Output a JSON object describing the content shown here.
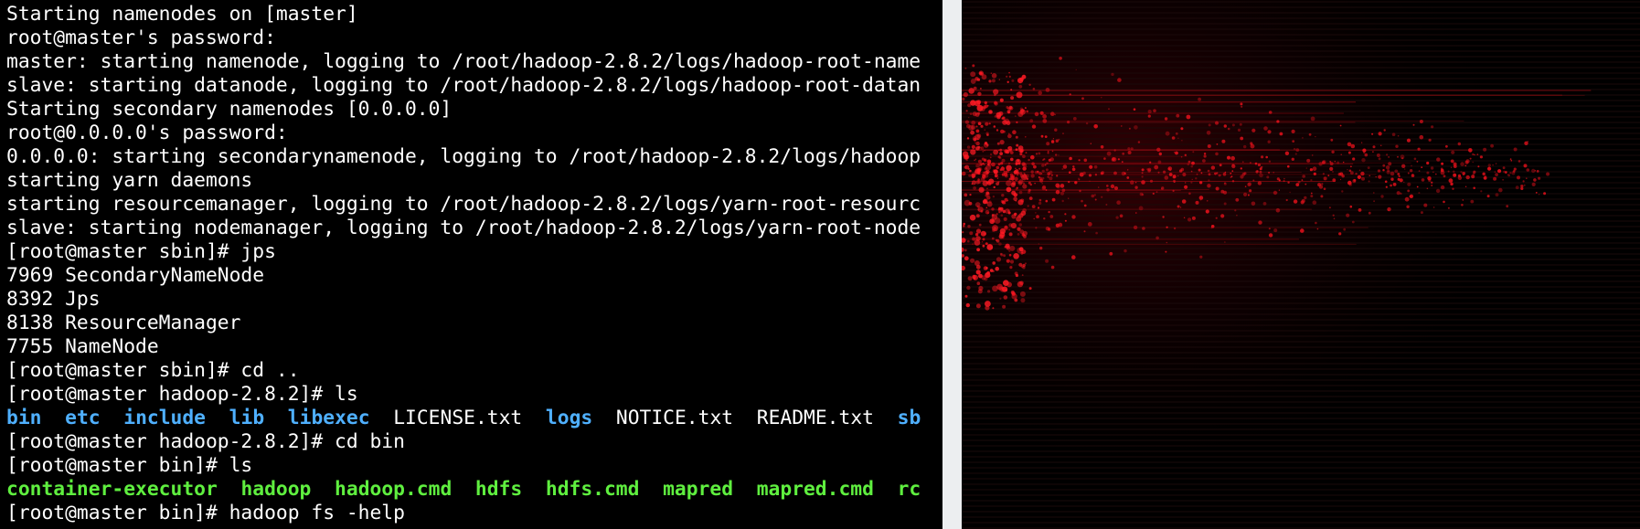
{
  "terminal": {
    "lines": [
      [
        {
          "t": "Starting namenodes on [master]",
          "c": "plain"
        }
      ],
      [
        {
          "t": "root@master's password:",
          "c": "plain"
        }
      ],
      [
        {
          "t": "master: starting namenode, logging to /root/hadoop-2.8.2/logs/hadoop-root-name",
          "c": "plain"
        }
      ],
      [
        {
          "t": "slave: starting datanode, logging to /root/hadoop-2.8.2/logs/hadoop-root-datan",
          "c": "plain"
        }
      ],
      [
        {
          "t": "Starting secondary namenodes [0.0.0.0]",
          "c": "plain"
        }
      ],
      [
        {
          "t": "root@0.0.0.0's password:",
          "c": "plain"
        }
      ],
      [
        {
          "t": "0.0.0.0: starting secondarynamenode, logging to /root/hadoop-2.8.2/logs/hadoop",
          "c": "plain"
        }
      ],
      [
        {
          "t": "starting yarn daemons",
          "c": "plain"
        }
      ],
      [
        {
          "t": "starting resourcemanager, logging to /root/hadoop-2.8.2/logs/yarn-root-resourc",
          "c": "plain"
        }
      ],
      [
        {
          "t": "slave: starting nodemanager, logging to /root/hadoop-2.8.2/logs/yarn-root-node",
          "c": "plain"
        }
      ],
      [
        {
          "t": "[root@master sbin]# jps",
          "c": "plain"
        }
      ],
      [
        {
          "t": "7969 SecondaryNameNode",
          "c": "plain"
        }
      ],
      [
        {
          "t": "8392 Jps",
          "c": "plain"
        }
      ],
      [
        {
          "t": "8138 ResourceManager",
          "c": "plain"
        }
      ],
      [
        {
          "t": "7755 NameNode",
          "c": "plain"
        }
      ],
      [
        {
          "t": "[root@master sbin]# cd ..",
          "c": "plain"
        }
      ],
      [
        {
          "t": "[root@master hadoop-2.8.2]# ls",
          "c": "plain"
        }
      ],
      [
        {
          "t": "bin",
          "c": "dir"
        },
        {
          "t": "  ",
          "c": "plain"
        },
        {
          "t": "etc",
          "c": "dir"
        },
        {
          "t": "  ",
          "c": "plain"
        },
        {
          "t": "include",
          "c": "dir"
        },
        {
          "t": "  ",
          "c": "plain"
        },
        {
          "t": "lib",
          "c": "dir"
        },
        {
          "t": "  ",
          "c": "plain"
        },
        {
          "t": "libexec",
          "c": "dir"
        },
        {
          "t": "  ",
          "c": "plain"
        },
        {
          "t": "LICENSE.txt",
          "c": "file"
        },
        {
          "t": "  ",
          "c": "plain"
        },
        {
          "t": "logs",
          "c": "dir"
        },
        {
          "t": "  ",
          "c": "plain"
        },
        {
          "t": "NOTICE.txt",
          "c": "file"
        },
        {
          "t": "  ",
          "c": "plain"
        },
        {
          "t": "README.txt",
          "c": "file"
        },
        {
          "t": "  ",
          "c": "plain"
        },
        {
          "t": "sb",
          "c": "dir"
        }
      ],
      [
        {
          "t": "[root@master hadoop-2.8.2]# cd bin",
          "c": "plain"
        }
      ],
      [
        {
          "t": "[root@master bin]# ls",
          "c": "plain"
        }
      ],
      [
        {
          "t": "container-executor",
          "c": "exec"
        },
        {
          "t": "  ",
          "c": "plain"
        },
        {
          "t": "hadoop",
          "c": "exec"
        },
        {
          "t": "  ",
          "c": "plain"
        },
        {
          "t": "hadoop.cmd",
          "c": "exec"
        },
        {
          "t": "  ",
          "c": "plain"
        },
        {
          "t": "hdfs",
          "c": "exec"
        },
        {
          "t": "  ",
          "c": "plain"
        },
        {
          "t": "hdfs.cmd",
          "c": "exec"
        },
        {
          "t": "  ",
          "c": "plain"
        },
        {
          "t": "mapred",
          "c": "exec"
        },
        {
          "t": "  ",
          "c": "plain"
        },
        {
          "t": "mapred.cmd",
          "c": "exec"
        },
        {
          "t": "  ",
          "c": "plain"
        },
        {
          "t": "rc",
          "c": "exec"
        }
      ],
      [
        {
          "t": "[root@master bin]# hadoop fs -help",
          "c": "plain"
        }
      ]
    ]
  },
  "colors": {
    "terminal_bg": "#000000",
    "terminal_fg": "#ffffff",
    "directory": "#4fb0ff",
    "executable": "#5fef3f",
    "divider": "#eceef0",
    "wallpaper_accent": "#e0101a"
  }
}
